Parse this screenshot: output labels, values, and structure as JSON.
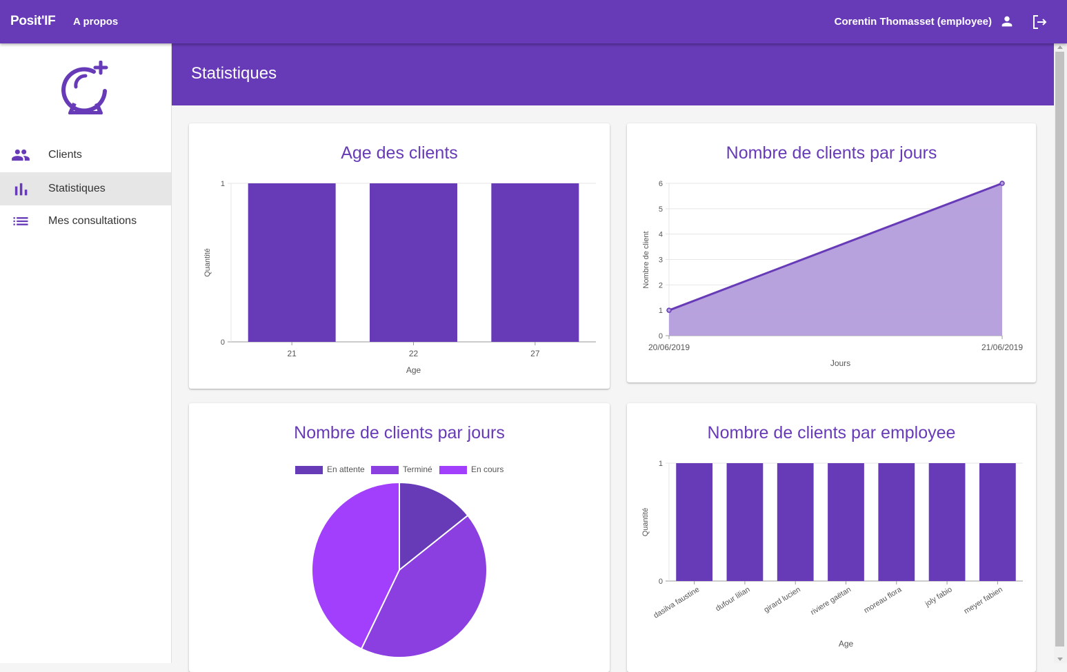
{
  "topbar": {
    "brand": "Posit'IF",
    "about": "A propos",
    "user": "Corentin Thomasset (employee)"
  },
  "sidebar": {
    "items": [
      {
        "label": "Clients",
        "icon": "people-icon"
      },
      {
        "label": "Statistiques",
        "icon": "bar-chart-icon",
        "active": true
      },
      {
        "label": "Mes consultations",
        "icon": "list-icon"
      }
    ]
  },
  "page": {
    "title": "Statistiques"
  },
  "colors": {
    "primary": "#673ab7",
    "accent1": "#8b3fe0",
    "accent2": "#a23ffc",
    "area_fill": "#b39ddb"
  },
  "chart_data": [
    {
      "type": "bar",
      "title": "Age des clients",
      "categories": [
        "21",
        "22",
        "27"
      ],
      "values": [
        1,
        1,
        1
      ],
      "xlabel": "Age",
      "ylabel": "Quantité",
      "ylim": [
        0,
        1
      ],
      "yticks": [
        0,
        1
      ]
    },
    {
      "type": "area",
      "title": "Nombre de clients par jours",
      "x": [
        "20/06/2019",
        "21/06/2019"
      ],
      "values": [
        1,
        6
      ],
      "xlabel": "Jours",
      "ylabel": "Nombre de client",
      "ylim": [
        0,
        6
      ],
      "yticks": [
        0,
        1,
        2,
        3,
        4,
        5,
        6
      ]
    },
    {
      "type": "pie",
      "title": "Nombre de clients par jours",
      "labels": [
        "En attente",
        "Terminé",
        "En cours"
      ],
      "values": [
        1,
        3,
        3
      ],
      "colors": [
        "#673ab7",
        "#8b3fe0",
        "#a23ffc"
      ],
      "legend": "top"
    },
    {
      "type": "bar",
      "title": "Nombre de clients par employee",
      "categories": [
        "dasilva faustine",
        "dufour lilian",
        "girard lucien",
        "riviere gaëtan",
        "moreau flora",
        "joly fabio",
        "meyer fabien"
      ],
      "values": [
        1,
        1,
        1,
        1,
        1,
        1,
        1
      ],
      "xlabel": "Age",
      "ylabel": "Quantité",
      "ylim": [
        0,
        1
      ],
      "yticks": [
        0,
        1
      ]
    }
  ]
}
